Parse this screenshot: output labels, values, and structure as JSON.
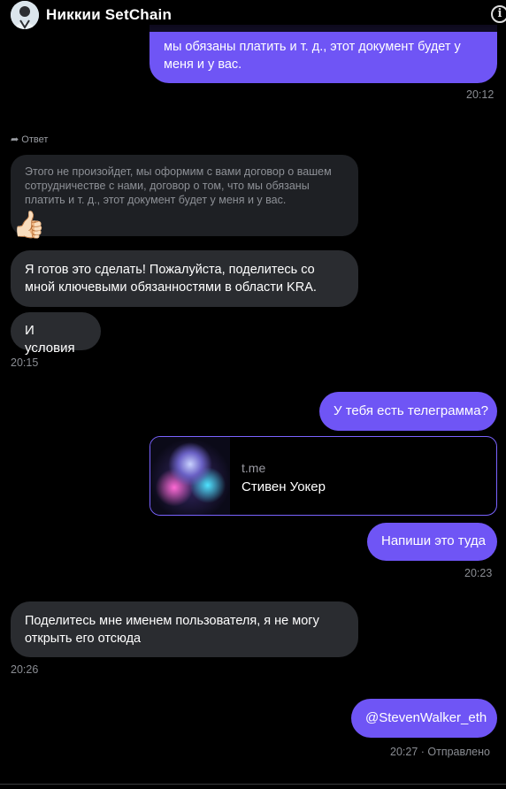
{
  "header": {
    "title": "Никкии SetChain"
  },
  "messages": {
    "top_out": "мы обязаны платить и т. д., этот документ будет у меня и у вас.",
    "top_out_time": "20:12",
    "reply_label": "Ответ",
    "quoted_text": "Этого не произойдет, мы оформим с вами договор о вашем сотрудничестве с нами, договор о том, что мы обязаны платить и т. д., этот документ будет у меня и у вас.",
    "thumb": "👍🏻",
    "in_1": "Я готов это сделать! Пожалуйста, поделитесь со мной ключевыми обязанностями в области KRA.",
    "in_2": "И условия",
    "in_2_time": "20:15",
    "out_1": "У тебя есть телеграмма?",
    "link_domain": "t.me",
    "link_name": "Стивен Уокер",
    "out_2": "Напиши это туда",
    "out_2_time": "20:23",
    "in_3": "Поделитесь мне именем пользователя, я не могу открыть его отсюда",
    "in_3_time": "20:26",
    "out_3": "@StevenWalker_eth",
    "out_3_status": "20:27 · Отправлено"
  },
  "colors": {
    "outgoing_bubble": "#6f55f5",
    "incoming_bubble": "#2a2c30",
    "link_border": "#7a63ff"
  },
  "icons": {
    "info": "info-icon",
    "reply": "reply-arrow-icon"
  }
}
